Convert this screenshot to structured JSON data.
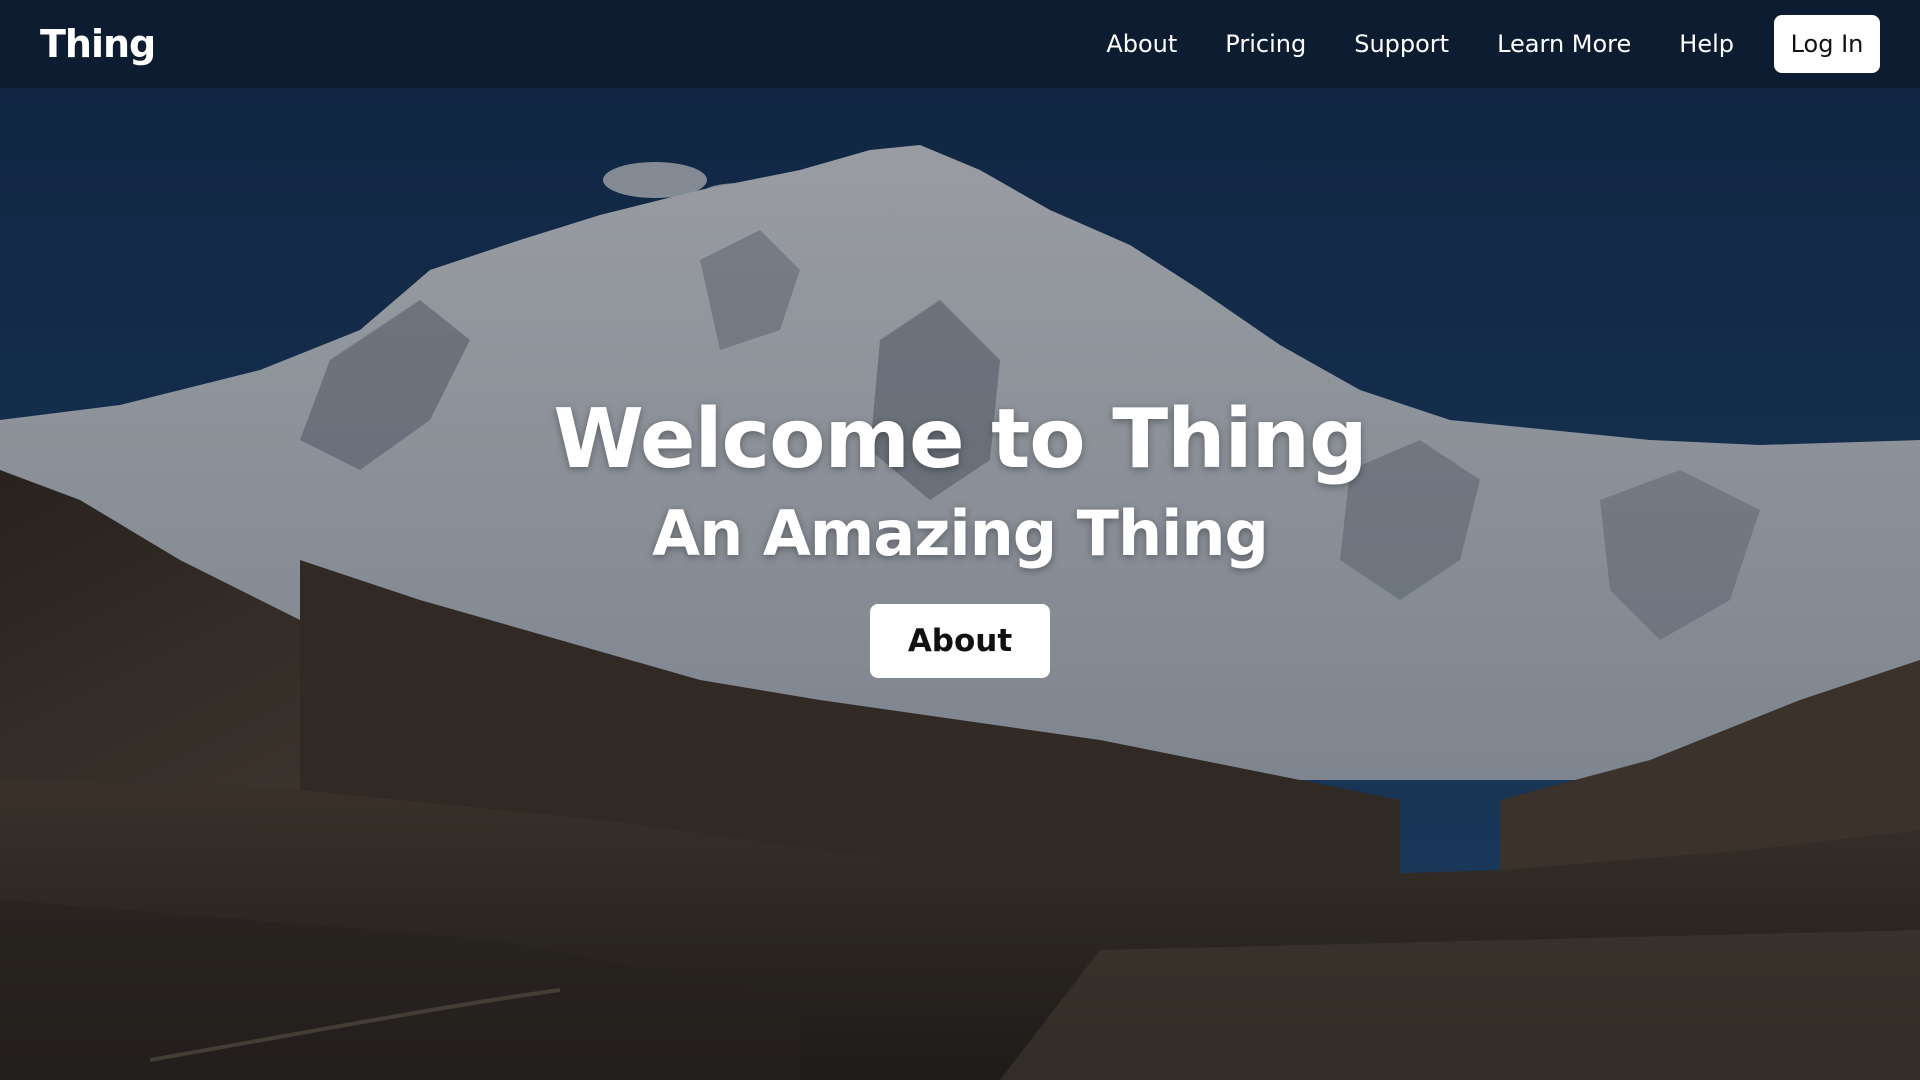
{
  "navbar": {
    "brand": "Thing",
    "links": [
      {
        "label": "About"
      },
      {
        "label": "Pricing"
      },
      {
        "label": "Support"
      },
      {
        "label": "Learn More"
      },
      {
        "label": "Help"
      }
    ],
    "login_label": "Log In"
  },
  "hero": {
    "title": "Welcome to Thing",
    "subtitle": "An Amazing Thing",
    "button_label": "About",
    "background": "snow-capped-mountain-photo"
  },
  "colors": {
    "navbar_bg": "#0e1c30",
    "sky": "#1d3f6b",
    "snow": "#e9edf2",
    "button_bg": "#ffffff",
    "button_text": "#111111"
  }
}
